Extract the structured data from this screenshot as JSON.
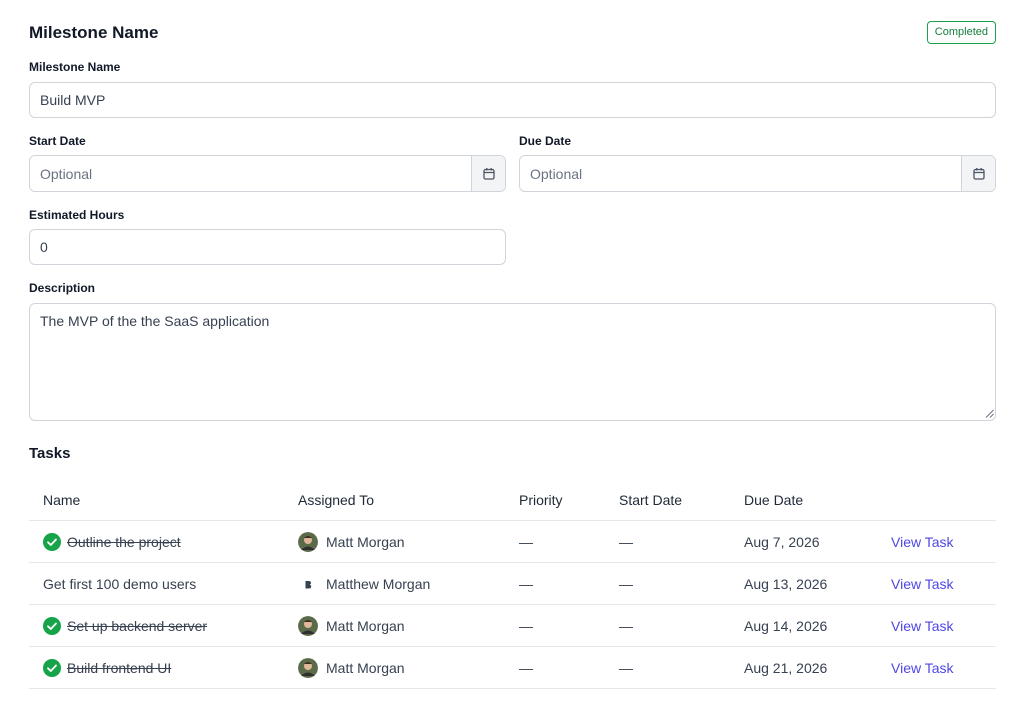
{
  "header": {
    "title": "Milestone Name",
    "status": "Completed"
  },
  "form": {
    "name_label": "Milestone Name",
    "name_value": "Build MVP",
    "start_label": "Start Date",
    "start_placeholder": "Optional",
    "due_label": "Due Date",
    "due_placeholder": "Optional",
    "hours_label": "Estimated Hours",
    "hours_value": "0",
    "description_label": "Description",
    "description_value": "The MVP of the the SaaS application"
  },
  "tasks": {
    "title": "Tasks",
    "columns": [
      "Name",
      "Assigned To",
      "Priority",
      "Start Date",
      "Due Date"
    ],
    "rows": [
      {
        "name": "Outline the project",
        "assignee": "Matt Morgan",
        "priority": "—",
        "start": "—",
        "due": "Aug 7, 2026",
        "action": "View Task"
      },
      {
        "name": "Get first 100 demo users",
        "assignee": "Matthew Morgan",
        "priority": "—",
        "start": "—",
        "due": "Aug 13, 2026",
        "action": "View Task"
      },
      {
        "name": "Set up backend server",
        "assignee": "Matt Morgan",
        "priority": "—",
        "start": "—",
        "due": "Aug 14, 2026",
        "action": "View Task"
      },
      {
        "name": "Build frontend UI",
        "assignee": "Matt Morgan",
        "priority": "—",
        "start": "—",
        "due": "Aug 21, 2026",
        "action": "View Task"
      }
    ]
  },
  "colors": {
    "accent": "#4f46e5",
    "success": "#16a34a"
  }
}
